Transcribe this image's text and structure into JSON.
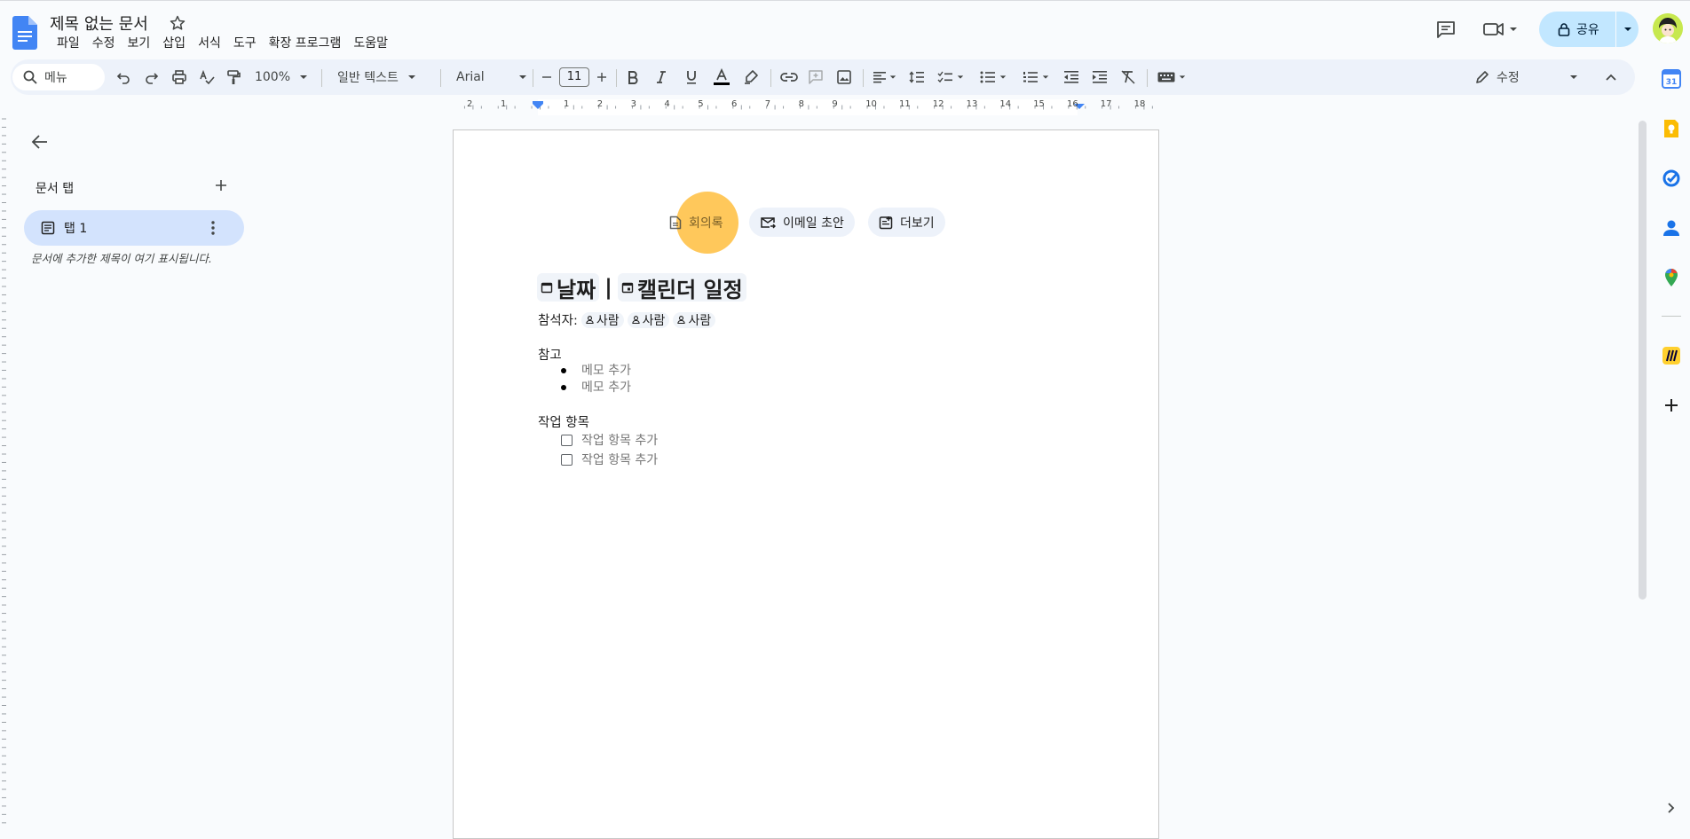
{
  "app": {
    "doc_title": "제목 없는 문서"
  },
  "menus": [
    "파일",
    "수정",
    "보기",
    "삽입",
    "서식",
    "도구",
    "확장 프로그램",
    "도움말"
  ],
  "header": {
    "share_label": "공유"
  },
  "toolbar": {
    "search_label": "메뉴",
    "zoom": "100%",
    "style": "일반 텍스트",
    "font": "Arial",
    "font_size": "11",
    "mode": "수정"
  },
  "ruler": {
    "left_ticks": [
      "2",
      "1"
    ],
    "ticks": [
      "1",
      "2",
      "3",
      "4",
      "5",
      "6",
      "7",
      "8",
      "9",
      "10",
      "11",
      "12",
      "13",
      "14",
      "15",
      "16",
      "17",
      "18"
    ]
  },
  "sidepanel": {
    "title": "문서 탭",
    "tab_label": "탭 1",
    "note": "문서에 추가한 제목이 여기 표시됩니다."
  },
  "doc": {
    "chips": [
      "회의록",
      "이메일 초안",
      "더보기"
    ],
    "heading_date": "날짜",
    "heading_sep": "|",
    "heading_event": "캘린더 일정",
    "attendees_label": "참석자:",
    "people": [
      "사람",
      "사람",
      "사람"
    ],
    "notes_title": "참고",
    "notes": [
      "메모 추가",
      "메모 추가"
    ],
    "actions_title": "작업 항목",
    "actions": [
      "작업 항목 추가",
      "작업 항목 추가"
    ]
  },
  "colors": {
    "accent": "#0b57d0",
    "share_bg": "#c2e7ff",
    "tab_active": "#d3e3fd",
    "highlight": "#ffb82d"
  }
}
